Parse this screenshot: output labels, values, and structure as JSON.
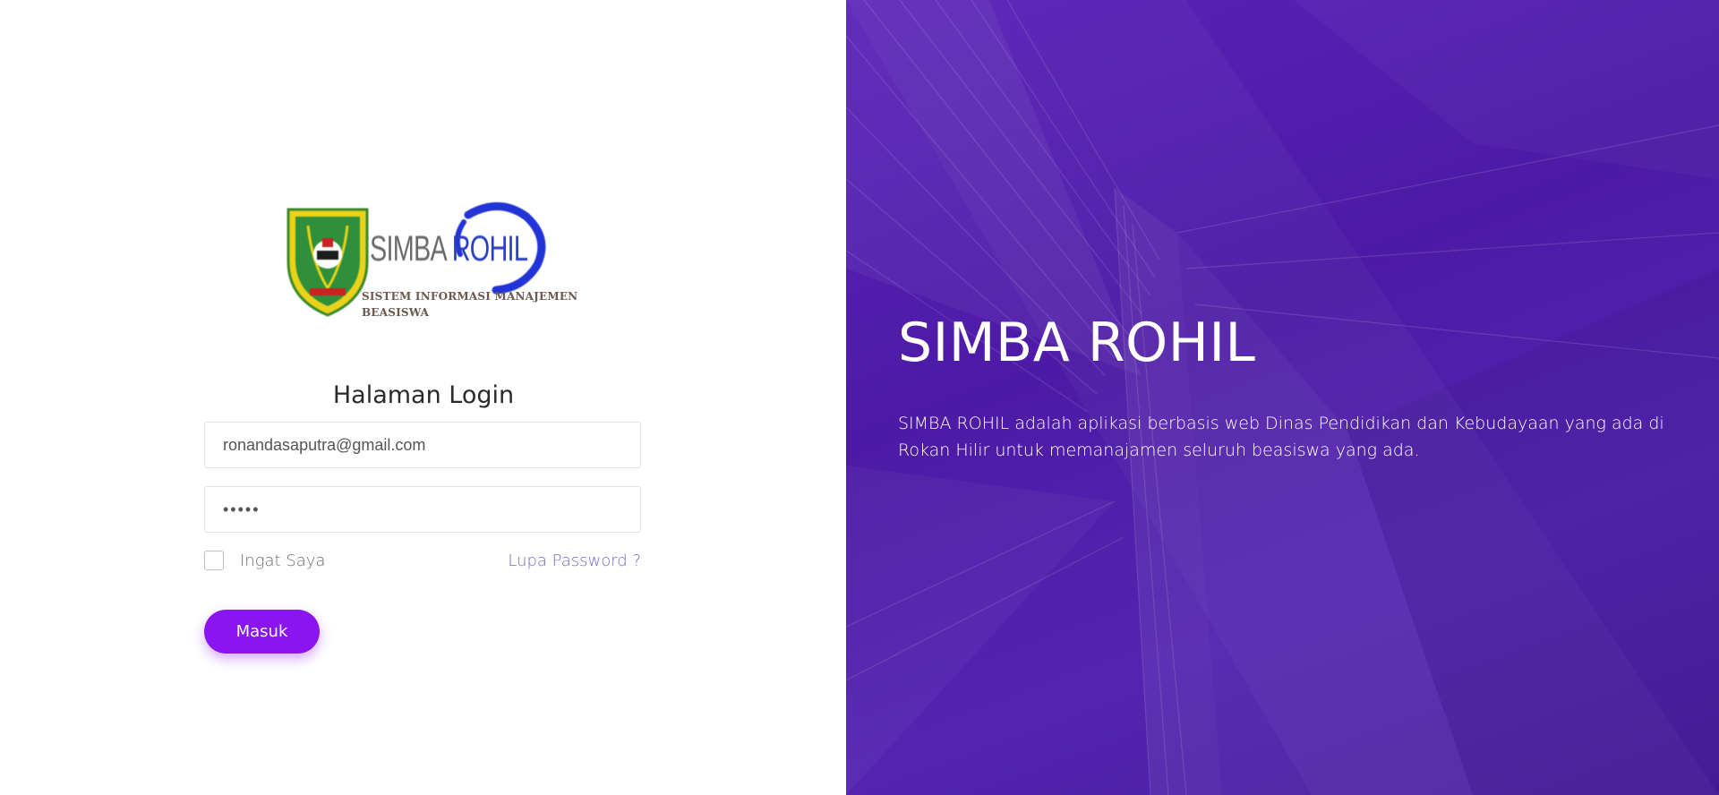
{
  "logo": {
    "title_part1": "SIMBA ",
    "title_part2": "ROHIL",
    "subtitle_line1": "SISTEM INFORMASI MANAJEMEN",
    "subtitle_line2": "BEASISWA"
  },
  "login": {
    "title": "Halaman Login",
    "email_value": "ronandasaputra@gmail.com",
    "password_value": "•••••",
    "remember_label": "Ingat Saya",
    "remember_checked": false,
    "forgot_label": "Lupa Password ?",
    "submit_label": "Masuk"
  },
  "hero": {
    "title": "SIMBA ROHIL",
    "description": "SIMBA ROHIL adalah aplikasi berbasis web Dinas Pendidikan dan Kebudayaan yang ada di Rokan Hilir untuk memanajamen seluruh beasiswa yang ada."
  },
  "colors": {
    "accent": "#8a15f0",
    "hero_bg": "#4f1ca8",
    "link": "#7a66c8"
  }
}
